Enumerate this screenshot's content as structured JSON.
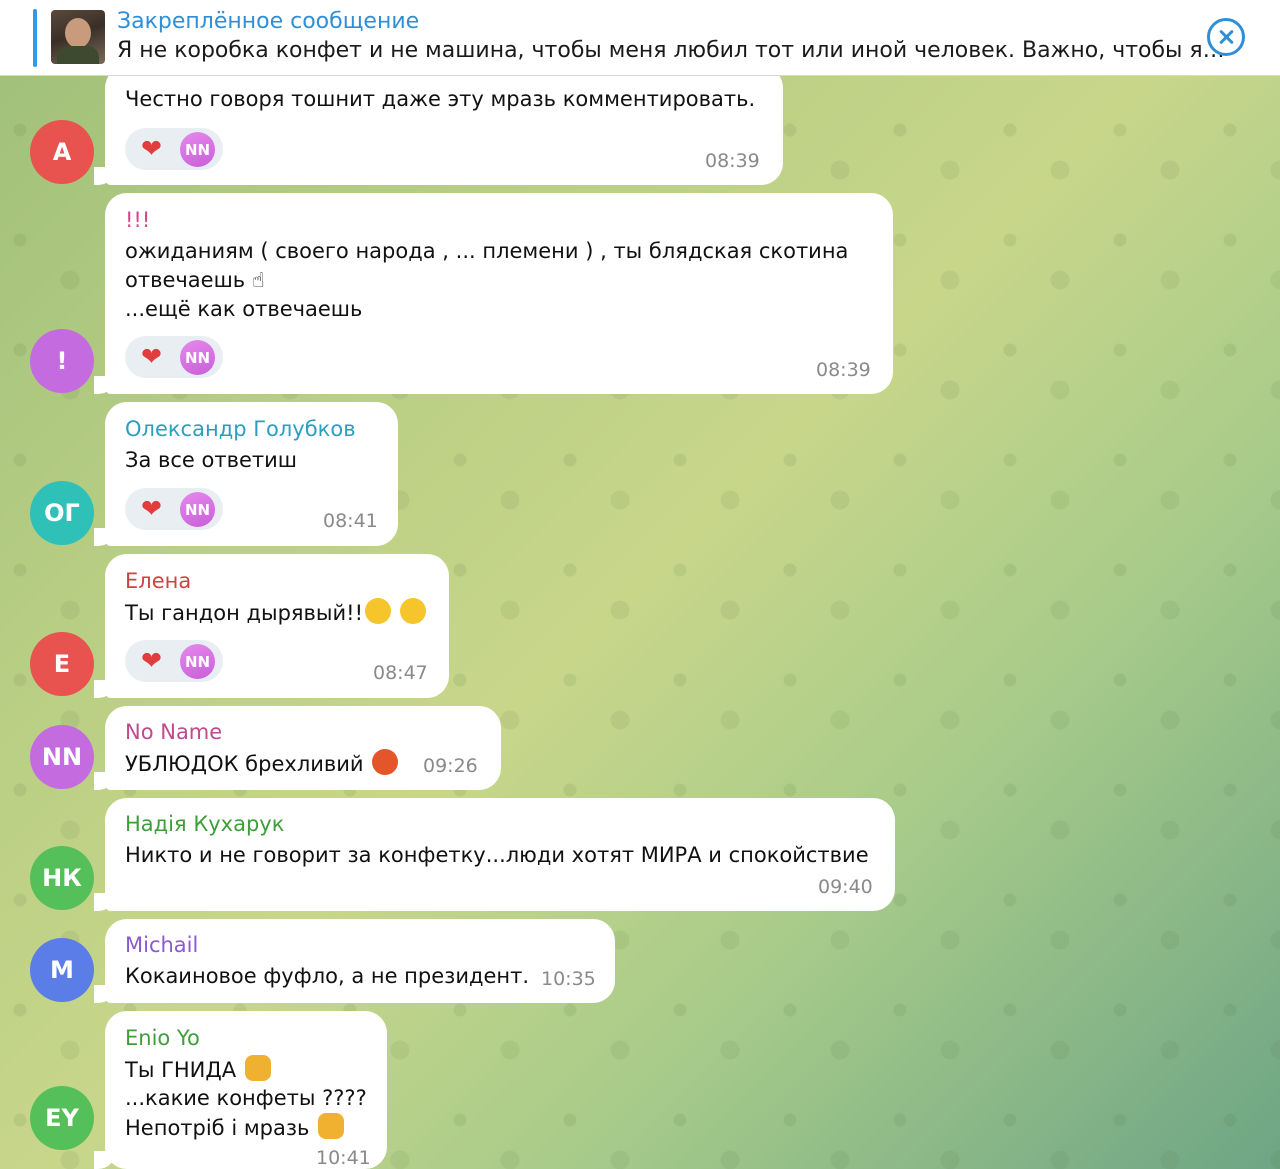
{
  "pinned": {
    "title": "Закреплённое сообщение",
    "text": "Я не коробка конфет и не машина, чтобы меня любил тот или иной человек. Важно, чтобы я…"
  },
  "reaction": {
    "heart": "❤",
    "user": "NN"
  },
  "messages": [
    {
      "avatar": "A",
      "avatar_color": "#e8534f",
      "sender": "",
      "lines": [
        "Честно говоря тошнит даже эту мразь комментировать."
      ],
      "time": "08:39",
      "has_reaction": true
    },
    {
      "avatar": "!",
      "avatar_color": "#c56be0",
      "sender": "!!!",
      "sender_color": "#d9448a",
      "lines": [
        "ожиданиям ( своего народа ,  ... племени  ) ,  ты блядская скотина",
        "отвечаешь ☝",
        "...ещё как отвечаешь"
      ],
      "time": "08:39",
      "has_reaction": true
    },
    {
      "avatar": "ОГ",
      "avatar_color": "#2fc0b8",
      "sender": "Олександр Голубков",
      "sender_color": "#2a9fc0",
      "lines": [
        "За все ответиш"
      ],
      "time": "08:41",
      "has_reaction": true
    },
    {
      "avatar": "Е",
      "avatar_color": "#e8534f",
      "sender": "Елена",
      "sender_color": "#d0423f",
      "lines": [
        "Ты гандон дырявый!!"
      ],
      "time": "08:47",
      "has_reaction": true
    },
    {
      "avatar": "NN",
      "avatar_color": "#c56be0",
      "sender": "No Name",
      "sender_color": "#c04a8c",
      "lines": [
        "УБЛЮДОК брехливий"
      ],
      "time": "09:26",
      "has_reaction": false
    },
    {
      "avatar": "НК",
      "avatar_color": "#55c05a",
      "sender": "Надія Кухарук",
      "sender_color": "#3e9f3a",
      "lines": [
        "Никто и не говорит за конфетку...люди хотят МИРА и спокойствие"
      ],
      "time": "09:40",
      "has_reaction": false
    },
    {
      "avatar": "M",
      "avatar_color": "#5b7de8",
      "sender": "Michail",
      "sender_color": "#8a5ad0",
      "lines": [
        "Кокаиновое фуфло, а не президент."
      ],
      "time": "10:35",
      "has_reaction": false
    },
    {
      "avatar": "EY",
      "avatar_color": "#55c05a",
      "sender": "Enio Yo",
      "sender_color": "#3e9f3a",
      "lines": [
        "Ты ГНИДА",
        "...какие конфеты ????",
        "Непотріб і мразь"
      ],
      "time": "10:41",
      "has_reaction": false
    }
  ]
}
